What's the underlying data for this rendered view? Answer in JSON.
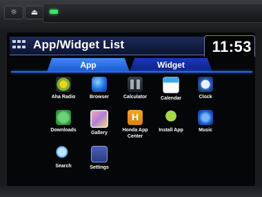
{
  "device": {
    "buttons": [
      {
        "name": "brightness",
        "glyph": "☼"
      },
      {
        "name": "eject",
        "glyph": "⏏"
      }
    ]
  },
  "header": {
    "title": "App/Widget List",
    "time": "11:53"
  },
  "tabs": [
    {
      "label": "App",
      "active": true
    },
    {
      "label": "Widget",
      "active": false
    }
  ],
  "apps": [
    {
      "label": "Aha Radio",
      "icon": "aha-radio-icon"
    },
    {
      "label": "Browser",
      "icon": "browser-icon"
    },
    {
      "label": "Calculator",
      "icon": "calculator-icon"
    },
    {
      "label": "Calendar",
      "icon": "calendar-icon"
    },
    {
      "label": "Clock",
      "icon": "clock-icon"
    },
    {
      "label": "Downloads",
      "icon": "downloads-icon"
    },
    {
      "label": "Gallery",
      "icon": "gallery-icon"
    },
    {
      "label": "Honda App Center",
      "icon": "honda-app-center-icon"
    },
    {
      "label": "Install App",
      "icon": "install-app-icon"
    },
    {
      "label": "Music",
      "icon": "music-icon"
    },
    {
      "label": "Search",
      "icon": "search-icon"
    },
    {
      "label": "Settings",
      "icon": "settings-icon"
    }
  ],
  "colors": {
    "accent": "#2e6ae0",
    "tab_active": "#3f8af2",
    "tab_inactive": "#1a39b9",
    "led": "#3ee46a"
  }
}
